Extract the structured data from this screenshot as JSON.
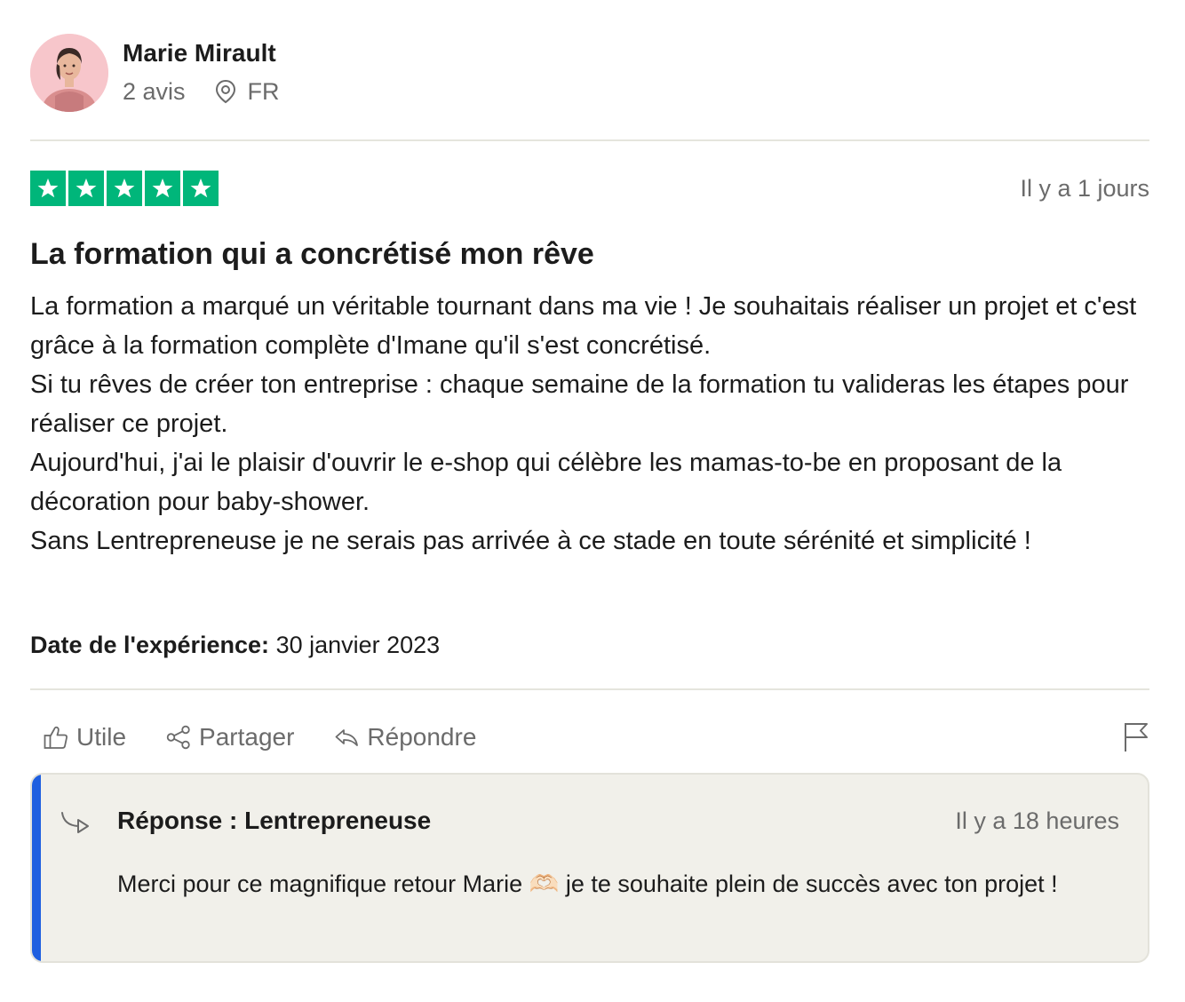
{
  "reviewer": {
    "name": "Marie Mirault",
    "reviews_count": "2 avis",
    "country": "FR"
  },
  "review": {
    "rating": 5,
    "star_color": "#00b67a",
    "date": "Il y a 1 jours",
    "title": "La formation qui a concrétisé mon rêve",
    "paragraphs": [
      "La formation a marqué un véritable tournant dans ma vie ! Je souhaitais réaliser un projet et c'est grâce à la formation complète d'Imane qu'il s'est concrétisé.",
      "Si tu rêves de créer ton entreprise : chaque semaine de la formation tu valideras les étapes pour réaliser ce projet.",
      "Aujourd'hui, j'ai le plaisir d'ouvrir le e-shop qui célèbre les mamas-to-be en proposant de la décoration pour baby-shower.",
      "Sans Lentrepreneuse je ne serais pas arrivée à ce stade en toute sérénité et simplicité !"
    ],
    "experience_label": "Date de l'expérience:",
    "experience_date": "30 janvier 2023"
  },
  "actions": {
    "useful_label": "Utile",
    "share_label": "Partager",
    "reply_label": "Répondre",
    "icons": [
      "thumbs-up-icon",
      "share-icon",
      "reply-icon",
      "flag-icon"
    ]
  },
  "reply": {
    "title": "Réponse : Lentrepreneuse",
    "date": "Il y a 18 heures",
    "text_before": "Merci pour ce magnifique retour Marie ",
    "emoji": "🫶🏻",
    "text_after": " je te souhaite plein de succès avec ton projet !",
    "accent_color": "#1f5fe0"
  }
}
